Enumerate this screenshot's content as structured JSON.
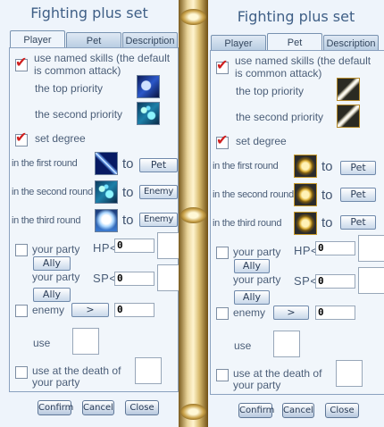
{
  "left_panel": {
    "title": "Fighting plus set",
    "tabs": [
      "Player",
      "Pet",
      "Description"
    ],
    "active_tab": "Player",
    "use_named_skills": {
      "checked": true,
      "label_line1": "use named skills (the default",
      "label_line2": "is common attack)"
    },
    "top_priority": {
      "label": "the top priority",
      "skill_icon": "moon-skill-icon"
    },
    "second_priority": {
      "label": "the second priority",
      "skill_icon": "bubble-skill-icon"
    },
    "set_degree": {
      "checked": true,
      "label": "set degree"
    },
    "rounds": [
      {
        "label": "in the first round",
        "skill_icon": "slash-skill-icon",
        "to": "to",
        "target": "Pet"
      },
      {
        "label": "in the second round",
        "skill_icon": "bubble-skill-icon",
        "to": "to",
        "target": "Enemy"
      },
      {
        "label": "in the third round",
        "skill_icon": "angel-skill-icon",
        "to": "to",
        "target": "Enemy"
      }
    ],
    "party_hp": {
      "checked": false,
      "label": "your party",
      "stat": "HP<",
      "value": "0",
      "button": "Ally"
    },
    "party_sp": {
      "label": "your party",
      "stat": "SP<",
      "value": "0",
      "button": "Ally"
    },
    "enemy": {
      "checked": false,
      "label": "enemy",
      "button": ">",
      "value": "0"
    },
    "use_label": "use",
    "death": {
      "checked": false,
      "label_line1": "use at the death of",
      "label_line2": "your party"
    },
    "footer": {
      "confirm": "Confirm",
      "cancel": "Cancel",
      "close": "Close"
    }
  },
  "right_panel": {
    "title": "Fighting plus set",
    "tabs": [
      "Player",
      "Pet",
      "Description"
    ],
    "active_tab": "Pet",
    "use_named_skills": {
      "checked": true,
      "label_line1": "use named skills (the default",
      "label_line2": "is common attack)"
    },
    "top_priority": {
      "label": "the top priority",
      "skill_icon": "sword-skill-icon"
    },
    "second_priority": {
      "label": "the second priority",
      "skill_icon": "sword-skill-icon"
    },
    "set_degree": {
      "checked": true,
      "label": "set degree"
    },
    "rounds": [
      {
        "label": "in the first round",
        "skill_icon": "shield-skill-icon",
        "to": "to",
        "target": "Pet"
      },
      {
        "label": "in the second round",
        "skill_icon": "shield-skill-icon",
        "to": "to",
        "target": "Pet"
      },
      {
        "label": "in the third round",
        "skill_icon": "shield-skill-icon",
        "to": "to",
        "target": "Pet"
      }
    ],
    "party_hp": {
      "checked": false,
      "label": "your party",
      "stat": "HP<",
      "value": "0",
      "button": "Ally"
    },
    "party_sp": {
      "label": "your party",
      "stat": "SP<",
      "value": "0",
      "button": "Ally"
    },
    "enemy": {
      "checked": false,
      "label": "enemy",
      "button": ">",
      "value": "0"
    },
    "use_label": "use",
    "death": {
      "checked": false,
      "label_line1": "use at the death of",
      "label_line2": "your party"
    },
    "footer": {
      "confirm": "Confirm",
      "cancel": "Cancel",
      "close": "Close"
    }
  },
  "colors": {
    "accent_check": "#d0201f",
    "panel_bg": "#eef4fb",
    "divider_gold": "#d8bb6f"
  }
}
